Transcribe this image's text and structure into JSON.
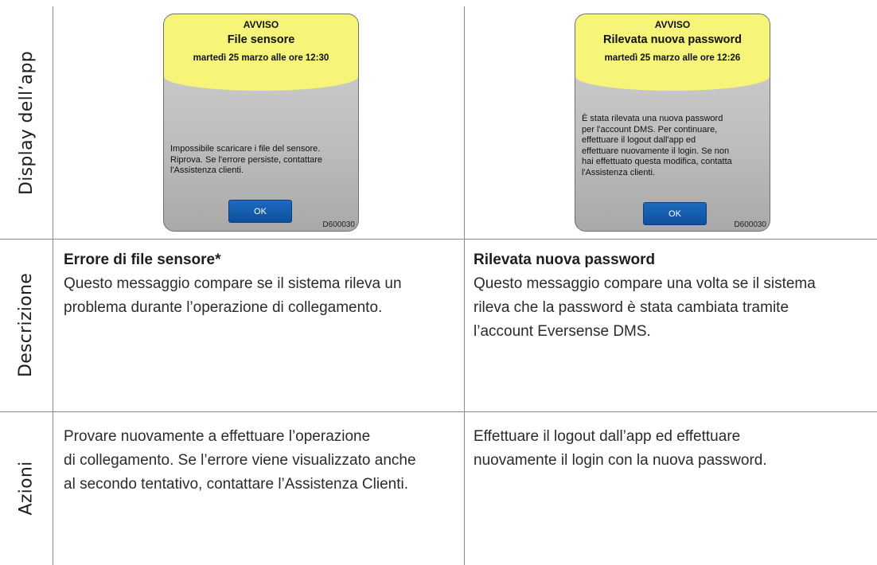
{
  "row_labels": {
    "display": "Display dell’app",
    "description": "Descrizione",
    "actions": "Azioni"
  },
  "left": {
    "dialog": {
      "header": "AVVISO",
      "title": "File sensore",
      "date": "martedì 25 marzo alle ore 12:30",
      "body_lines": [
        "Impossibile scaricare i file del sensore.",
        "Riprova. Se l'errore persiste, contattare",
        "l'Assistenza clienti."
      ],
      "ok_label": "OK",
      "code": "D600030"
    },
    "description": {
      "title": "Errore di file sensore*",
      "lines": [
        "Questo messaggio compare se il sistema rileva un",
        "problema durante l’operazione di collegamento."
      ]
    },
    "actions": {
      "lines": [
        "Provare nuovamente a effettuare l’operazione",
        "di collegamento. Se l’errore viene visualizzato anche",
        "al secondo tentativo, contattare l’Assistenza Clienti."
      ]
    }
  },
  "right": {
    "dialog": {
      "header": "AVVISO",
      "title": "Rilevata nuova password",
      "date": "martedì 25 marzo alle ore 12:26",
      "body_lines": [
        "È stata rilevata una nuova password",
        "per l'account DMS. Per continuare,",
        "effettuare il logout dall'app ed",
        "effettuare nuovamente il login. Se non",
        "hai effettuato questa modifica, contatta",
        "l'Assistenza clienti."
      ],
      "ok_label": "OK",
      "code": "D600030"
    },
    "description": {
      "title": "Rilevata nuova password",
      "lines": [
        "Questo messaggio compare una volta se il sistema",
        "rileva che la password è stata cambiata tramite",
        "l’account Eversense DMS."
      ]
    },
    "actions": {
      "lines": [
        "Effettuare il logout dall’app ed effettuare",
        "nuovamente il login con la nuova password."
      ]
    }
  }
}
